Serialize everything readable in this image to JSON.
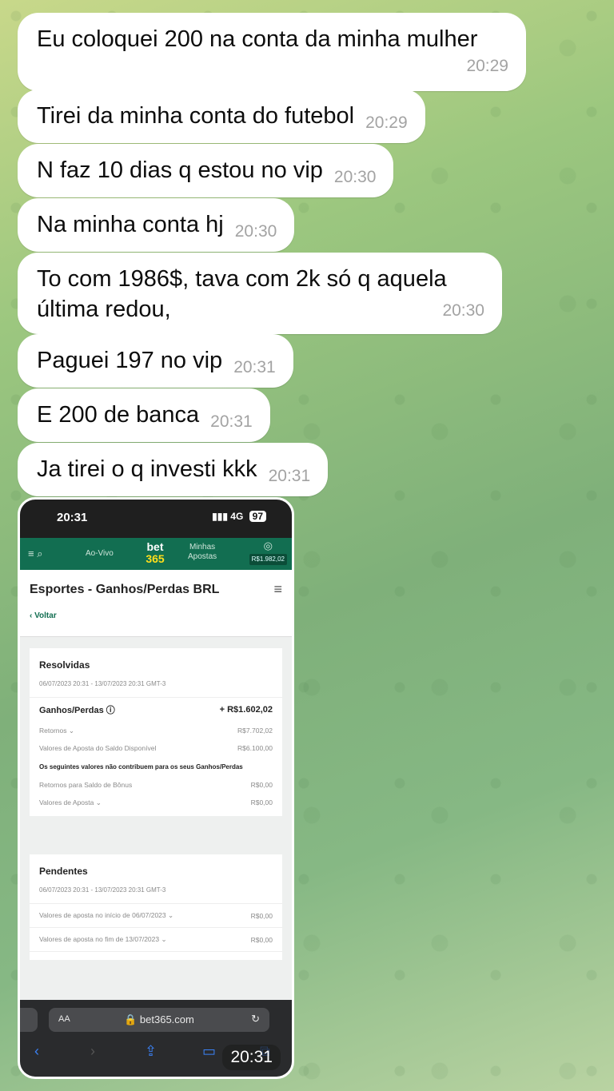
{
  "messages": [
    {
      "text": "Eu coloquei 200 na conta da minha mulher",
      "time": "20:29"
    },
    {
      "text": "Tirei da minha conta do futebol",
      "time": "20:29"
    },
    {
      "text": "N faz 10 dias q estou no vip",
      "time": "20:30"
    },
    {
      "text": "Na minha conta hj",
      "time": "20:30"
    },
    {
      "text_line1": "To com 1986$, tava com 2k só q aquela",
      "text_line2": "última redou,",
      "time": "20:30"
    },
    {
      "text": "Paguei 197 no vip",
      "time": "20:31"
    },
    {
      "text": "E 200 de banca",
      "time": "20:31"
    },
    {
      "text": "Ja tirei o q investi kkk",
      "time": "20:31"
    }
  ],
  "photo": {
    "time": "20:31",
    "status": {
      "time": "20:31",
      "network": "4G",
      "battery": "97"
    },
    "nav": {
      "live": "Ao-Vivo",
      "logo_top": "bet",
      "logo_bottom": "365",
      "my_bets_1": "Minhas",
      "my_bets_2": "Apostas",
      "balance": "R$1.982,02"
    },
    "header": {
      "title": "Esportes - Ganhos/Perdas BRL",
      "back": "‹ Voltar"
    },
    "resolved": {
      "title": "Resolvidas",
      "range": "06/07/2023 20:31 - 13/07/2023 20:31 GMT-3",
      "gains_label": "Ganhos/Perdas ⓘ",
      "gains_value": "+ R$1.602,02",
      "returns_label": "Retornos ⌄",
      "returns_value": "R$7.702,02",
      "stakes_label": "Valores de Aposta do Saldo Disponível",
      "stakes_value": "R$6.100,00",
      "note": "Os seguintes valores não contribuem para os seus Ganhos/Perdas",
      "bonus_label": "Retornos para Saldo de Bônus",
      "bonus_value": "R$0,00",
      "bet_values_label": "Valores de Aposta ⌄",
      "bet_values_value": "R$0,00"
    },
    "pending": {
      "title": "Pendentes",
      "range": "06/07/2023 20:31 - 13/07/2023 20:31 GMT-3",
      "start_label": "Valores de aposta no início de 06/07/2023 ⌄",
      "start_value": "R$0,00",
      "end_label": "Valores de aposta no fim de 13/07/2023 ⌄",
      "end_value": "R$0,00"
    },
    "browser": {
      "aa": "AA",
      "url": "🔒 bet365.com"
    }
  }
}
